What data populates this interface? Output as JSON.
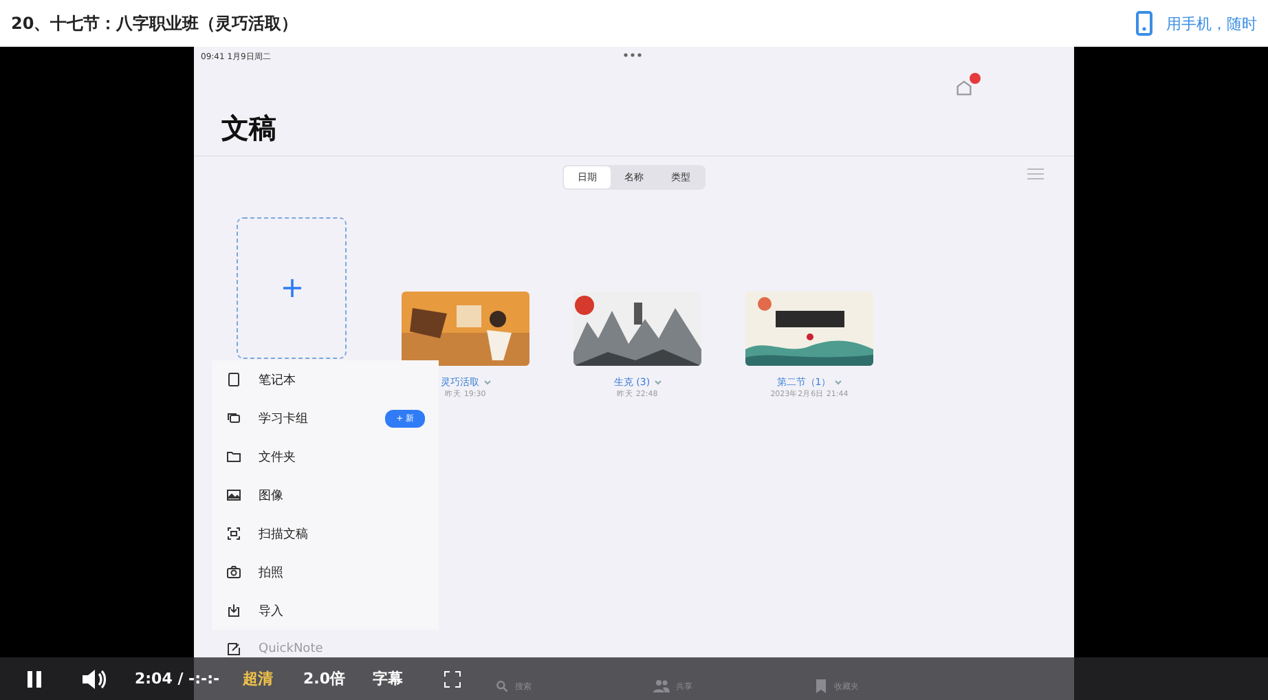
{
  "header": {
    "title": "20、十七节：八字职业班（灵巧活取）",
    "mobile_link": "用手机，随时"
  },
  "ipad": {
    "status_time": "09:41  1月9日周二",
    "title": "文稿",
    "sort_tabs": [
      {
        "label": "日期",
        "selected": true
      },
      {
        "label": "名称",
        "selected": false
      },
      {
        "label": "类型",
        "selected": false
      }
    ],
    "documents": [
      {
        "name": "灵巧活取",
        "date": "昨天 19:30"
      },
      {
        "name": "生克 (3)",
        "date": "昨天 22:48"
      },
      {
        "name": "第二节（1）",
        "date": "2023年2月6日 21:44"
      }
    ],
    "menu": [
      {
        "label": "笔记本"
      },
      {
        "label": "学习卡组",
        "badge": "+ 新"
      },
      {
        "label": "文件夹"
      },
      {
        "label": "图像"
      },
      {
        "label": "扫描文稿"
      },
      {
        "label": "拍照"
      },
      {
        "label": "导入"
      },
      {
        "label": "QuickNote"
      }
    ],
    "bottom_tabs": [
      {
        "label": "搜索"
      },
      {
        "label": "共享"
      },
      {
        "label": "收藏夹"
      }
    ]
  },
  "player": {
    "playing": true,
    "time": "2:04 / -:-:-",
    "quality": "超清",
    "speed": "2.0倍",
    "subtitles": "字幕"
  }
}
